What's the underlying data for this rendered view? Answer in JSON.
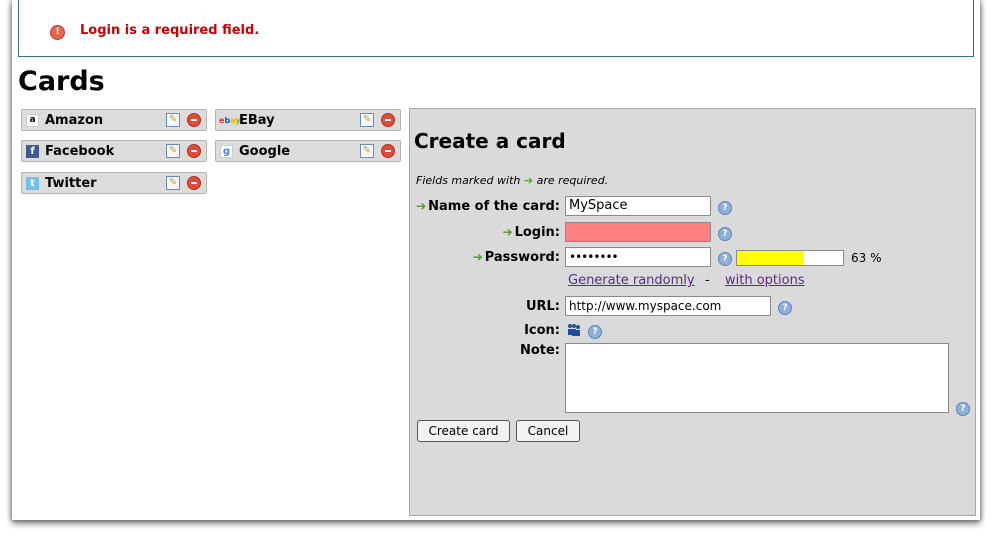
{
  "error": {
    "message": "Login is a required field."
  },
  "cards": {
    "title": "Cards",
    "items": [
      {
        "name": "Amazon",
        "logo": "amazon-logo"
      },
      {
        "name": "EBay",
        "logo": "ebay-logo"
      },
      {
        "name": "Facebook",
        "logo": "facebook-logo"
      },
      {
        "name": "Google",
        "logo": "google-logo"
      },
      {
        "name": "Twitter",
        "logo": "twitter-logo"
      }
    ]
  },
  "form": {
    "title": "Create a card",
    "required_note_before": "Fields marked with",
    "required_note_after": "are required.",
    "name_label": "Name of the card:",
    "name_value": "MySpace",
    "login_label": "Login:",
    "login_value": "",
    "password_label": "Password:",
    "password_value": "••••••••",
    "strength_percent": 63,
    "strength_text": "63 %",
    "generate_link": "Generate randomly",
    "separator": "-",
    "options_link": "with options",
    "url_label": "URL:",
    "url_value": "http://www.myspace.com",
    "icon_label": "Icon:",
    "note_label": "Note:",
    "create_button": "Create card",
    "cancel_button": "Cancel"
  },
  "colors": {
    "error_text": "#cc0000",
    "login_invalid_bg": "#ff8080",
    "strength_fill": "#ffff00",
    "link": "#5d2a80"
  }
}
